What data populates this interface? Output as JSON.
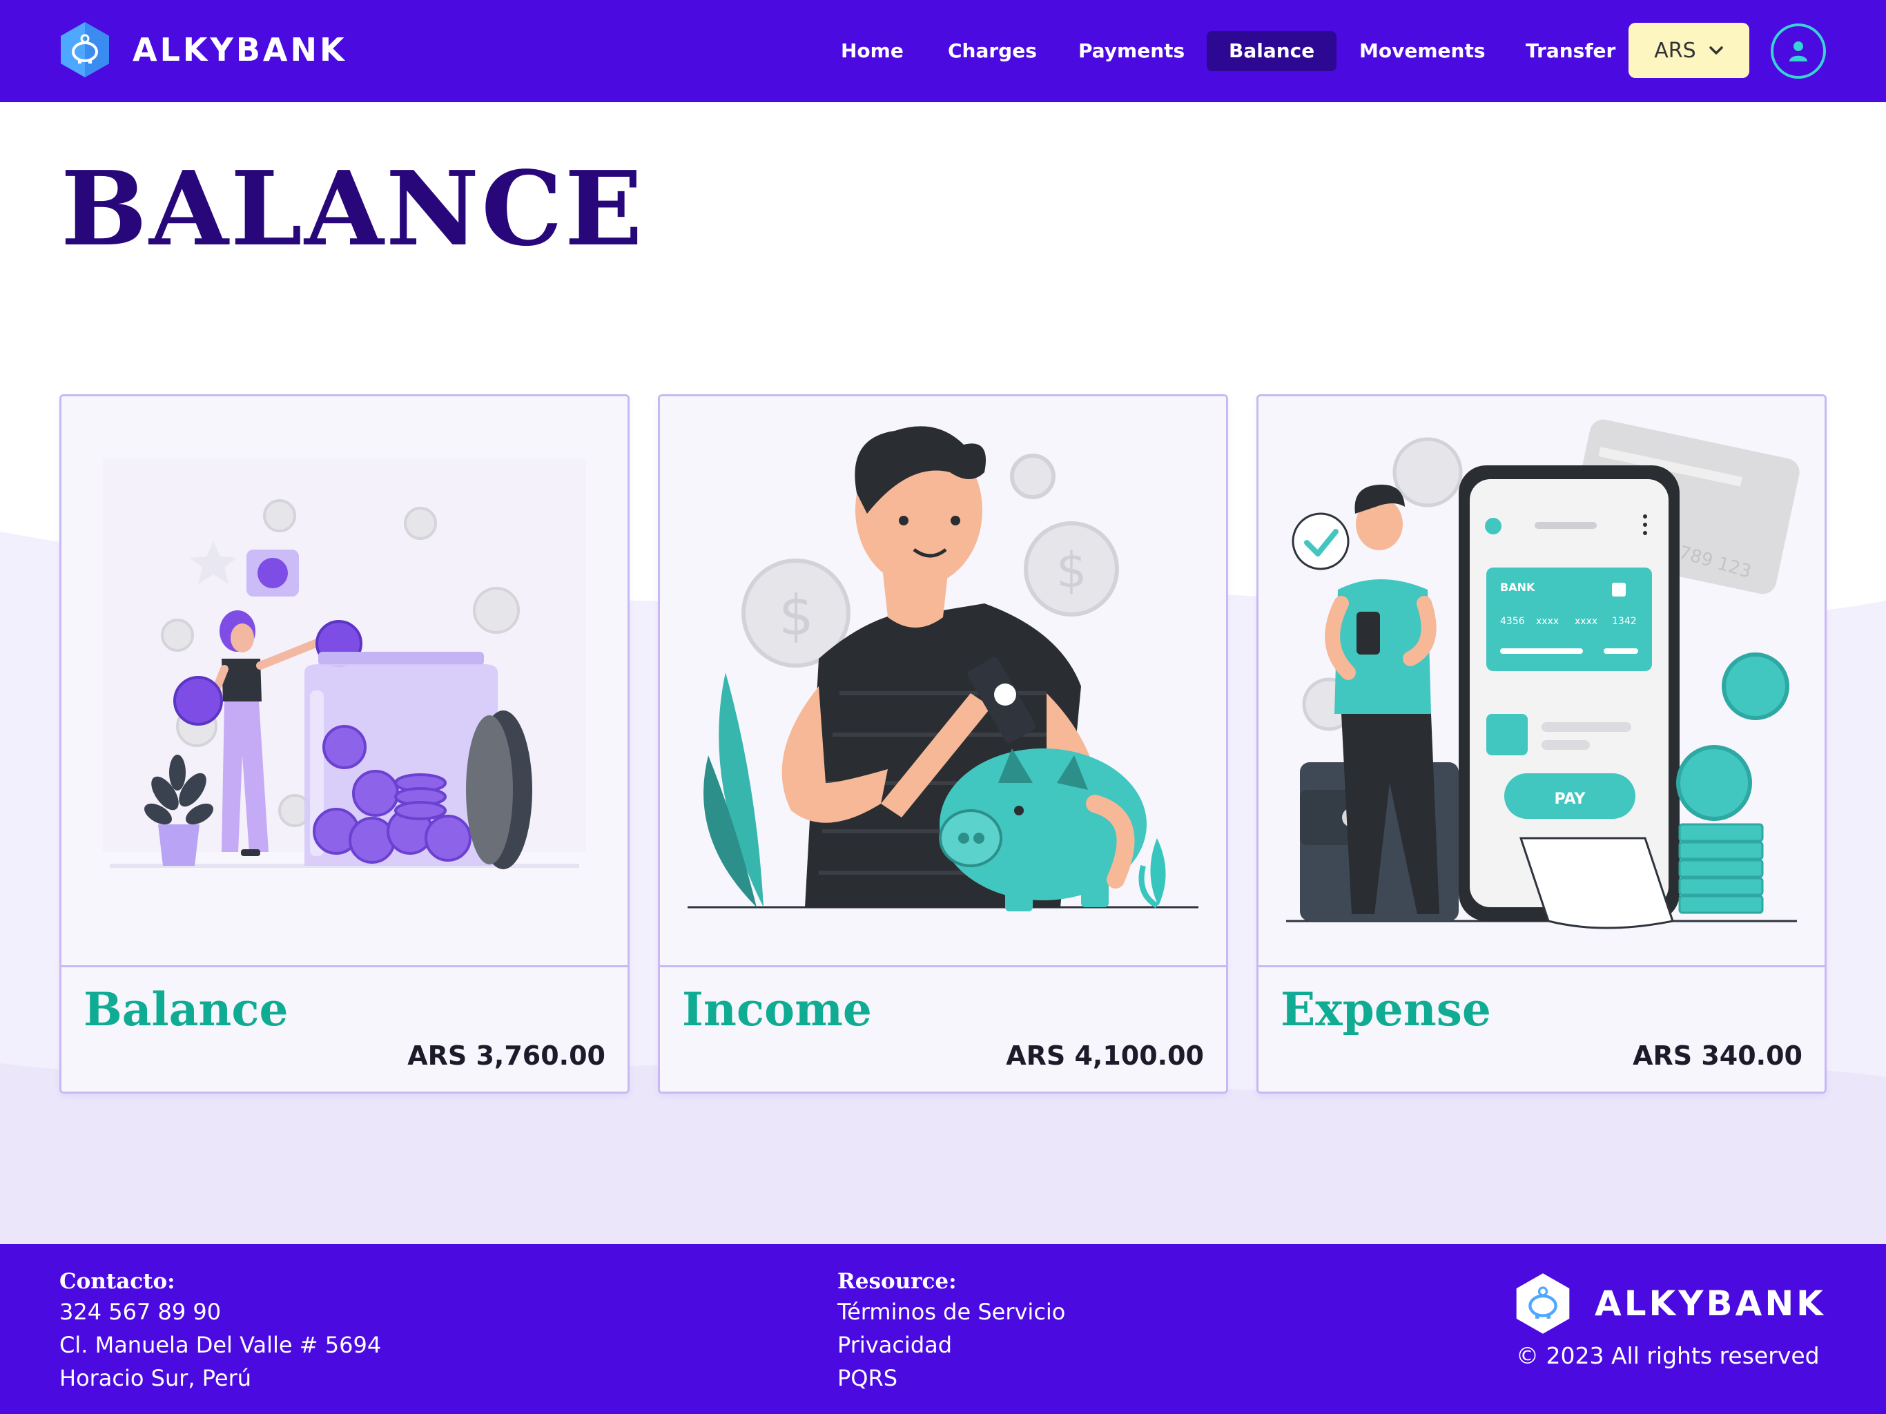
{
  "brand": {
    "name": "ALKYBANK"
  },
  "nav": [
    {
      "label": "Home",
      "active": false
    },
    {
      "label": "Charges",
      "active": false
    },
    {
      "label": "Payments",
      "active": false
    },
    {
      "label": "Balance",
      "active": true
    },
    {
      "label": "Movements",
      "active": false
    },
    {
      "label": "Transfer",
      "active": false
    }
  ],
  "currency": {
    "selected": "ARS",
    "icon": "chevron-down-icon"
  },
  "user": {
    "icon": "user-icon"
  },
  "page": {
    "title": "BALANCE"
  },
  "cards": [
    {
      "title": "Balance",
      "amount": "ARS 3,760.00",
      "illustration": "coin-jar-illustration"
    },
    {
      "title": "Income",
      "amount": "ARS 4,100.00",
      "illustration": "piggy-bank-illustration"
    },
    {
      "title": "Expense",
      "amount": "ARS 340.00",
      "illustration": "mobile-payment-illustration"
    }
  ],
  "card_illustration_texts": {
    "bank": "BANK",
    "card_number": [
      "4356",
      "xxxx",
      "xxxx",
      "1342"
    ],
    "pay": "PAY"
  },
  "footer": {
    "contact": {
      "heading": "Contacto:",
      "lines": [
        "324 567 89 90",
        "Cl. Manuela Del Valle # 5694",
        "Horacio Sur, Perú"
      ]
    },
    "resource": {
      "heading": "Resource:",
      "links": [
        "Términos de Servicio",
        "Privacidad",
        "PQRS"
      ]
    },
    "brand_name": "ALKYBANK",
    "copyright": "© 2023 All rights reserved"
  },
  "colors": {
    "primary": "#4a0ae0",
    "title": "#27077a",
    "accent_teal": "#0fab93",
    "currency_bg": "#fef6c0",
    "lavender": "#ebe6fa"
  }
}
